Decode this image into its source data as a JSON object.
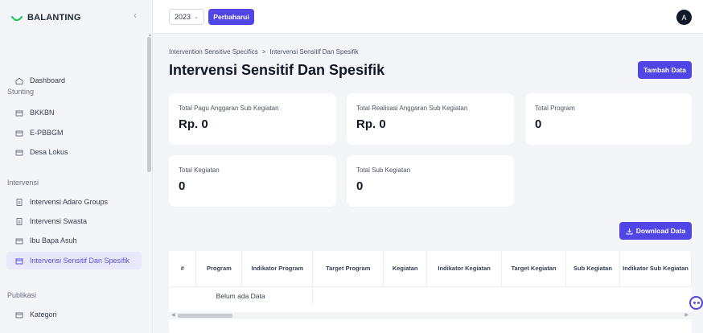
{
  "brand": {
    "name": "BALANTING"
  },
  "topbar": {
    "year": "2023",
    "refresh_label": "Perbaharui",
    "avatar_initial": "A"
  },
  "sidebar": {
    "dashboard": "Dashboard",
    "sections": {
      "stunting": "Stunting",
      "intervensi": "Intervensi",
      "publikasi": "Publikasi"
    },
    "items": [
      {
        "label": "BKKBN"
      },
      {
        "label": "E-PBBGM"
      },
      {
        "label": "Desa Lokus"
      },
      {
        "label": "Intervensi Adaro Groups"
      },
      {
        "label": "Intervensi Swasta"
      },
      {
        "label": "Ibu Bapa Asuh"
      },
      {
        "label": "Intervensi Sensitif Dan Spesifik",
        "active": true
      },
      {
        "label": "Kategori"
      }
    ]
  },
  "breadcrumb": {
    "parent": "Intervention Sensitive Specifics",
    "separator": ">",
    "current": "Intervensi Sensitif Dan Spesifik"
  },
  "page": {
    "title": "Intervensi Sensitif Dan Spesifik",
    "add_label": "Tambah Data",
    "download_label": "Download Data"
  },
  "stats": [
    {
      "label": "Total Pagu Anggaran Sub Kegiatan",
      "value": "Rp. 0"
    },
    {
      "label": "Total Realisasi Anggaran Sub Kegiatan",
      "value": "Rp. 0"
    },
    {
      "label": "Total Program",
      "value": "0"
    },
    {
      "label": "Total Kegiatan",
      "value": "0"
    },
    {
      "label": "Total Sub Kegiatan",
      "value": "0"
    }
  ],
  "table": {
    "columns": [
      "#",
      "Program",
      "Indikator Program",
      "Target Program",
      "Kegiatan",
      "Indikator Kegiatan",
      "Target Kegiatan",
      "Sub Kegiatan",
      "Indikator Sub Kegiatan"
    ],
    "empty_text": "Belum ada Data"
  },
  "colors": {
    "accent": "#5046e5",
    "active_bg": "#e9e8fb"
  },
  "icons": {
    "dashboard": "home-icon",
    "menu": "folder-icon",
    "doc": "document-icon",
    "chat": "chat-icon",
    "download": "download-icon"
  }
}
